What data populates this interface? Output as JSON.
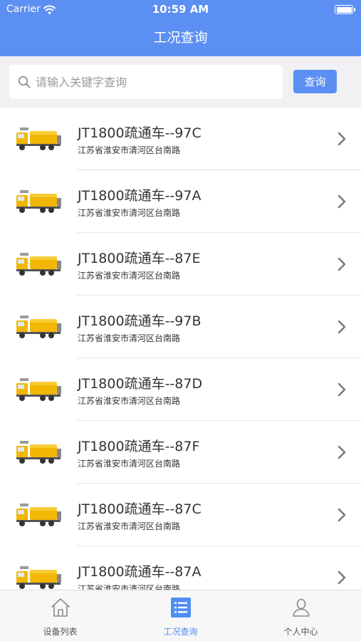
{
  "status_bar": {
    "carrier": "Carrier",
    "time": "10:59 AM"
  },
  "header": {
    "title": "工况查询"
  },
  "search": {
    "placeholder": "请输入关键字查询",
    "button_label": "查询"
  },
  "devices": [
    {
      "name": "JT1800疏通车--97C",
      "address": "江苏省淮安市清河区台南路"
    },
    {
      "name": "JT1800疏通车--97A",
      "address": "江苏省淮安市清河区台南路"
    },
    {
      "name": "JT1800疏通车--87E",
      "address": "江苏省淮安市清河区台南路"
    },
    {
      "name": "JT1800疏通车--97B",
      "address": "江苏省淮安市清河区台南路"
    },
    {
      "name": "JT1800疏通车--87D",
      "address": "江苏省淮安市清河区台南路"
    },
    {
      "name": "JT1800疏通车--87F",
      "address": "江苏省淮安市清河区台南路"
    },
    {
      "name": "JT1800疏通车--87C",
      "address": "江苏省淮安市清河区台南路"
    },
    {
      "name": "JT1800疏通车--87A",
      "address": "江苏省淮安市清河区台南路"
    }
  ],
  "tabbar": {
    "tabs": [
      {
        "label": "设备列表",
        "icon": "home-icon",
        "active": false
      },
      {
        "label": "工况查询",
        "icon": "list-icon",
        "active": true
      },
      {
        "label": "个人中心",
        "icon": "person-icon",
        "active": false
      }
    ]
  },
  "colors": {
    "primary": "#5b8ff2",
    "active_tab": "#4f8ef7",
    "truck_body": "#f2b705"
  }
}
